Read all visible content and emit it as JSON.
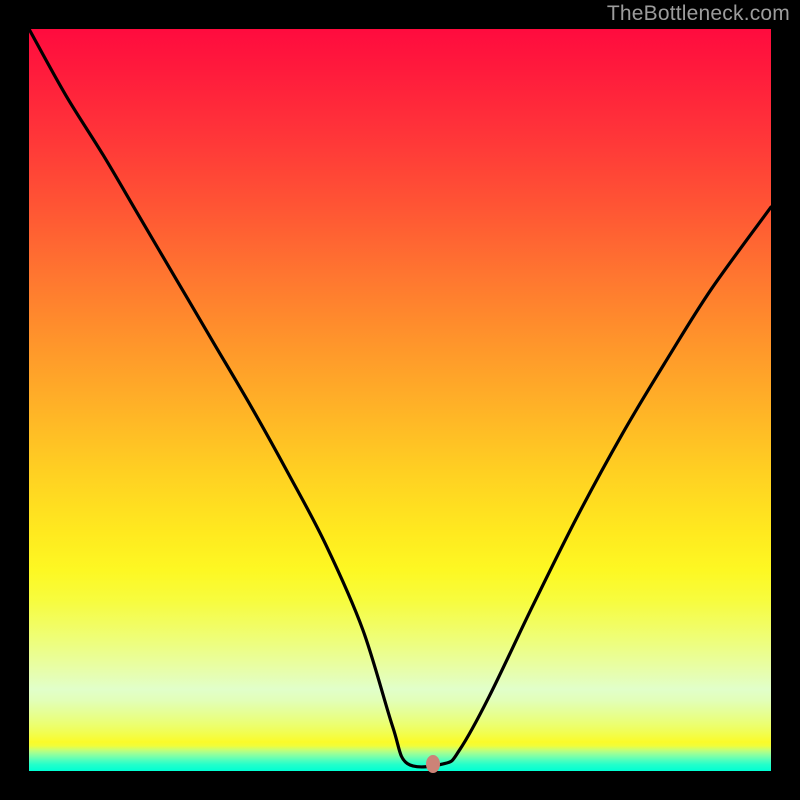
{
  "watermark": "TheBottleneck.com",
  "marker": {
    "x_frac": 0.545,
    "y_frac": 0.991
  },
  "chart_data": {
    "type": "line",
    "title": "",
    "xlabel": "",
    "ylabel": "",
    "xlim": [
      0,
      1
    ],
    "ylim": [
      0,
      1
    ],
    "grid": false,
    "legend": false,
    "background": "rainbow-vertical-gradient",
    "marker_point": {
      "x": 0.545,
      "y": 0.009
    },
    "series": [
      {
        "name": "curve",
        "x": [
          0.0,
          0.05,
          0.1,
          0.15,
          0.2,
          0.25,
          0.3,
          0.35,
          0.4,
          0.45,
          0.49,
          0.51,
          0.56,
          0.58,
          0.62,
          0.68,
          0.74,
          0.8,
          0.86,
          0.92,
          1.0
        ],
        "y": [
          1.0,
          0.91,
          0.83,
          0.745,
          0.66,
          0.575,
          0.49,
          0.4,
          0.305,
          0.19,
          0.06,
          0.01,
          0.01,
          0.028,
          0.1,
          0.225,
          0.345,
          0.455,
          0.555,
          0.65,
          0.76
        ]
      }
    ]
  }
}
